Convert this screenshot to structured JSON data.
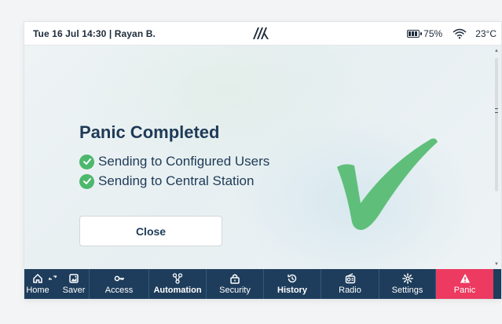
{
  "statusbar": {
    "datetime_user": "Tue 16 Jul 14:30 | Rayan B.",
    "battery": "75%",
    "temperature": "23°C"
  },
  "dialog": {
    "title": "Panic Completed",
    "items": [
      "Sending to Configured Users",
      "Sending to Central Station"
    ],
    "close_label": "Close"
  },
  "nav": {
    "home": "Home",
    "saver": "Saver",
    "access": "Access",
    "automation": "Automation",
    "security": "Security",
    "history": "History",
    "radio": "Radio",
    "settings": "Settings",
    "panic": "Panic"
  },
  "colors": {
    "nav_bg": "#1e3d5c",
    "panic": "#ec3a60",
    "check": "#4cb86d",
    "text": "#1e3a57"
  }
}
